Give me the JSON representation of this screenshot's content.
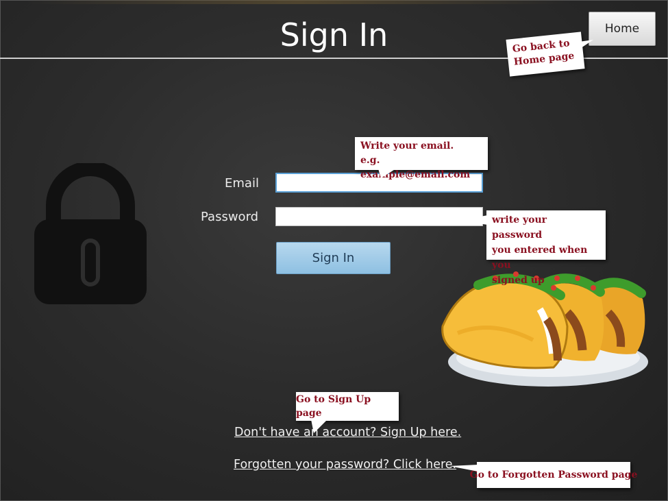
{
  "header": {
    "title": "Sign In",
    "home_button": "Home"
  },
  "form": {
    "email_label": "Email",
    "email_value": "",
    "password_label": "Password",
    "password_value": "",
    "submit_label": "Sign In"
  },
  "links": {
    "signup": "Don't have an account? Sign Up here.",
    "forgot": "Forgotten your password? Click here."
  },
  "annotations": {
    "home": [
      "Go back to",
      "Home page"
    ],
    "email": [
      "Write your email.",
      "e.g. example@email.com"
    ],
    "password": [
      "write your password",
      "you entered when you",
      "signed up"
    ],
    "signup": "Go to Sign Up page",
    "forgot": "Go to Forgotten Password page"
  },
  "colors": {
    "background": "#2c2c2c",
    "button_blue": "#8ec0e2",
    "annotation_text": "#8a1020"
  },
  "icons": [
    "lock-icon",
    "taco-illustration"
  ]
}
